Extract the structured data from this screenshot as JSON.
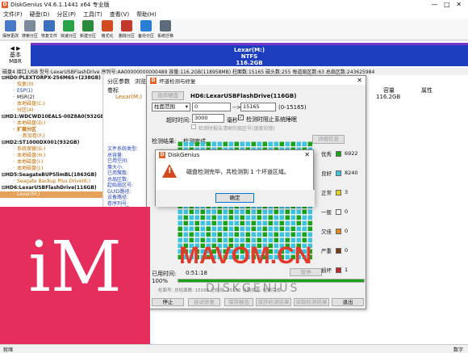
{
  "app": {
    "title": "DiskGenius V4.6.1.1441 x64 专业版",
    "logo": "D"
  },
  "menu": [
    "文件(F)",
    "硬盘(D)",
    "分区(P)",
    "工具(T)",
    "查看(V)",
    "帮助(H)"
  ],
  "toolbar": [
    {
      "label": "保存更改",
      "icon": "save-icon",
      "color": "#4a78c8"
    },
    {
      "label": "搜索分区",
      "icon": "search-icon",
      "color": "#7b8a9a"
    },
    {
      "label": "恢复文件",
      "icon": "recover-icon",
      "color": "#3c6fbd"
    },
    {
      "label": "快速分区",
      "icon": "quick-partition-icon",
      "color": "#29a34a"
    },
    {
      "label": "新建分区",
      "icon": "new-partition-icon",
      "color": "#2b8a3e"
    },
    {
      "label": "格式化",
      "icon": "format-icon",
      "color": "#d24a1e"
    },
    {
      "label": "删除分区",
      "icon": "delete-icon",
      "color": "#c0392b"
    },
    {
      "label": "备份分区",
      "icon": "backup-icon",
      "color": "#2a7fd4"
    },
    {
      "label": "系统迁移",
      "icon": "migrate-icon",
      "color": "#5a6b7c"
    }
  ],
  "diskmap": {
    "side_line1": "基本",
    "side_line2": "MBR",
    "part_name": "Lexar(M:)",
    "part_fs": "NTFS",
    "part_size": "116.2GB"
  },
  "infobar": "磁盘4 接口:USB 型号:LexarUSBFlashDrive 序列号:AA00000000000489 容量:116.2GB(118958MB) 柱面数:15165 磁头数:255 每道扇区数:63 总扇区数:243625984",
  "tree": [
    {
      "text": "HD0:PLEXTORPX-256M6S+(238GB)",
      "cls": "t-b",
      "indent": 0
    },
    {
      "text": "恢复(0)",
      "cls": "t-orange",
      "indent": 2
    },
    {
      "text": "ESP(1)",
      "cls": "t-blue",
      "indent": 2
    },
    {
      "text": "MSR(2)",
      "cls": "",
      "indent": 2
    },
    {
      "text": "本地磁盘(C:)",
      "cls": "t-orange",
      "indent": 2
    },
    {
      "text": "分区(4)",
      "cls": "t-orange",
      "indent": 2
    },
    {
      "text": "HD1:WDCWD10EALS-00Z8A0(932GB)",
      "cls": "t-b",
      "indent": 0
    },
    {
      "text": "本地磁盘(D:)",
      "cls": "t-orange",
      "indent": 2
    },
    {
      "text": "扩展分区",
      "cls": "t-orange t-b",
      "indent": 2
    },
    {
      "text": "新加卷(F:)",
      "cls": "t-orange",
      "indent": 3
    },
    {
      "text": "HD2:ST1000DX001(932GB)",
      "cls": "t-b",
      "indent": 0
    },
    {
      "text": "系统保留(G:)",
      "cls": "t-orange",
      "indent": 2
    },
    {
      "text": "本地磁盘(H:)",
      "cls": "t-orange",
      "indent": 2
    },
    {
      "text": "本地磁盘(I:)",
      "cls": "t-orange",
      "indent": 2
    },
    {
      "text": "本地磁盘(J:)",
      "cls": "t-orange",
      "indent": 2
    },
    {
      "text": "HD5:SeagateBUPSlimBL(1863GB)",
      "cls": "t-b",
      "indent": 0
    },
    {
      "text": "Seagate Backup Plus Drive(K:)",
      "cls": "t-orange",
      "indent": 2
    },
    {
      "text": "HD6:LexarUSBFlashDrive(116GB)",
      "cls": "t-b",
      "indent": 0
    },
    {
      "text": "Lexar(M:)",
      "cls": "t-sel",
      "indent": 2
    }
  ],
  "bgpanel": {
    "tabs": [
      "分区参数",
      "浏览文件"
    ],
    "col_label": "卷标",
    "row_label": "Lexar(M:)",
    "right_headers": [
      "容量",
      "属性"
    ],
    "right_cap": "116.2GB",
    "details": [
      "文件系统类型:",
      "总容量:",
      "已用空间:",
      "簇大小:",
      "已用簇数:",
      "总扇区数:",
      "起始扇区号:",
      "GUID路径:",
      "设备路径:",
      "卷序列号:",
      "$MFT簇号:",
      "$MFTMirr簇号:",
      "文件记录大小:",
      "卷GUID:"
    ]
  },
  "dialog": {
    "title": "坏道检测与修复",
    "select_disk": "选择硬盘",
    "disk_name": "HD6:LexarUSBFlashDrive(116GB)",
    "range_label": "柱面范围",
    "range_from": "0",
    "range_sep": "-->",
    "range_to": "15165",
    "range_hint": "(0-15165)",
    "timeout_label": "超时时间:",
    "timeout_value": "3000",
    "timeout_unit": "毫秒",
    "chk_sleep": "检测时阻止系统睡眠",
    "chk_report": "检测时报告清晰的扇区号(速度较慢)",
    "result_label": "检测结果:",
    "result_value": "检测完成。",
    "export_btn": "详细信息",
    "legend": [
      {
        "label": "优秀",
        "color": "#1aa31a",
        "count": "6922"
      },
      {
        "label": "良好",
        "color": "#3cc3e0",
        "count": "8240"
      },
      {
        "label": "正常",
        "color": "#e6d21e",
        "count": "3"
      },
      {
        "label": "一般",
        "color": "#f2f2f2",
        "count": "0"
      },
      {
        "label": "欠佳",
        "color": "#e08a1e",
        "count": "0"
      },
      {
        "label": "严重",
        "color": "#7a3a10",
        "count": "0"
      },
      {
        "label": "损坏",
        "color": "#c62828",
        "count": "1"
      }
    ],
    "elapsed_label": "已用时间:",
    "elapsed_value": "0:51:18",
    "elapsed_btn": "暂停",
    "progress_text": "100%",
    "progress": 1.0,
    "hint": "柱面号: 总柱面数: 15165 已检测: 15165 当前状态: 检测完成",
    "buttons": [
      "停止",
      "尝试修复",
      "保存报告",
      "保存检测结果",
      "读取检测结果",
      "退出"
    ]
  },
  "msgbox": {
    "title": "DiskGenius",
    "message": "磁盘检测完毕，共检测到 1 个坏道区域。",
    "ok": "确定"
  },
  "statusbar": {
    "left": "就绪",
    "right": "数字"
  },
  "watermark": {
    "logo": "iM",
    "site": "MAVOM.CN",
    "faded": "DISKGENIUS"
  }
}
